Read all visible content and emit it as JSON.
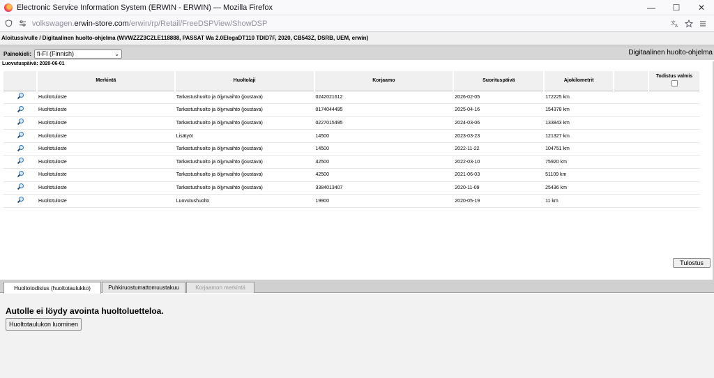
{
  "window": {
    "title": "Electronic Service Information System (ERWIN - ERWIN) — Mozilla Firefox",
    "minimize": "—",
    "maximize": "☐",
    "close": "✕"
  },
  "address": {
    "url_prefix": "volkswagen.",
    "url_host": "erwin-store.com",
    "url_path": "/erwin/rp/Retail/FreeDSPView/ShowDSP"
  },
  "vehicle_info": "Aloitussivulle / Digitaalinen huolto-ohjelma (WVWZZZ3CZLE118888, PASSAT Wa 2.0ElegaDT110 TDID7F, 2020, CB543Z, DSRB, UEM, erwin)",
  "language": {
    "label": "Painokieli:",
    "selected": "fi-FI (Finnish)"
  },
  "app_title": "Digitaalinen huolto-ohjelma",
  "delivery_date": "Luovutuspäivä: 2020-06-01",
  "table": {
    "headers": {
      "merkinta": "Merkintä",
      "huoltolaji": "Huoltolaji",
      "korjaamo": "Korjaamo",
      "suorituspaiva": "Suorituspäivä",
      "ajokilometrit": "Ajokilometrit",
      "empty": "",
      "todistus": "Todistus valmis"
    },
    "rows": [
      {
        "merkinta": "Huoltotuloste",
        "huoltolaji": "Tarkastushuolto ja öljynvaihto (joustava)",
        "korjaamo": "0242021612",
        "paiva": "2026-02-05",
        "km": "172225 km"
      },
      {
        "merkinta": "Huoltotuloste",
        "huoltolaji": "Tarkastushuolto ja öljynvaihto (joustava)",
        "korjaamo": "0174044495",
        "paiva": "2025-04-16",
        "km": "154378 km"
      },
      {
        "merkinta": "Huoltotuloste",
        "huoltolaji": "Tarkastushuolto ja öljynvaihto (joustava)",
        "korjaamo": "0227015495",
        "paiva": "2024-03-06",
        "km": "133843 km"
      },
      {
        "merkinta": "Huoltotuloste",
        "huoltolaji": "Lisätyöt",
        "korjaamo": "14500",
        "paiva": "2023-03-23",
        "km": "121327 km"
      },
      {
        "merkinta": "Huoltotuloste",
        "huoltolaji": "Tarkastushuolto ja öljynvaihto (joustava)",
        "korjaamo": "14500",
        "paiva": "2022-11-22",
        "km": "104751 km"
      },
      {
        "merkinta": "Huoltotuloste",
        "huoltolaji": "Tarkastushuolto ja öljynvaihto (joustava)",
        "korjaamo": "42500",
        "paiva": "2022-03-10",
        "km": "75920 km"
      },
      {
        "merkinta": "Huoltotuloste",
        "huoltolaji": "Tarkastushuolto ja öljynvaihto (joustava)",
        "korjaamo": "42500",
        "paiva": "2021-06-03",
        "km": "51109 km"
      },
      {
        "merkinta": "Huoltotuloste",
        "huoltolaji": "Tarkastushuolto ja öljynvaihto (joustava)",
        "korjaamo": "3384013407",
        "paiva": "2020-11-09",
        "km": "25436 km"
      },
      {
        "merkinta": "Huoltotuloste",
        "huoltolaji": "Luovutushuolto",
        "korjaamo": "19900",
        "paiva": "2020-05-19",
        "km": "11 km"
      }
    ]
  },
  "print_button": "Tulostus",
  "tabs": [
    {
      "label": "Huoltotodistus (huoltotaulukko)",
      "state": "active"
    },
    {
      "label": "Puhkiruostumattomuustakuu",
      "state": "normal"
    },
    {
      "label": "Korjaamon merkintä",
      "state": "disabled"
    }
  ],
  "bottom": {
    "message": "Autolle ei löydy avointa huoltoluetteloa.",
    "create_button": "Huoltotaulukon luominen"
  }
}
